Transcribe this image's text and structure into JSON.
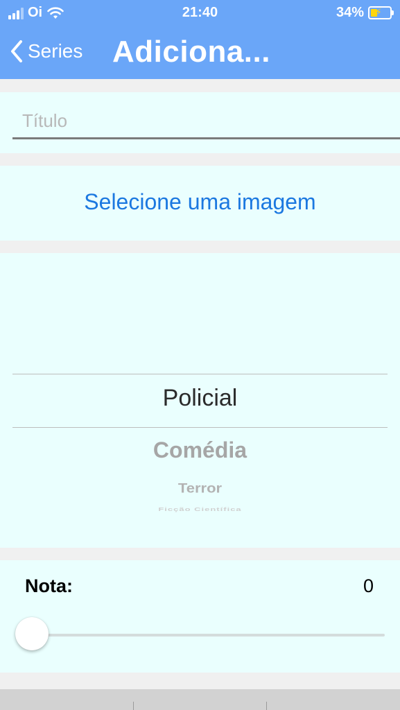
{
  "status_bar": {
    "carrier": "Oi",
    "time": "21:40",
    "battery_percent": "34%",
    "icons": [
      "signal-icon",
      "wifi-icon",
      "battery-charging-icon"
    ]
  },
  "nav": {
    "back_label": "Series",
    "title": "Adiciona..."
  },
  "form": {
    "title_placeholder": "Título",
    "select_image_label": "Selecione uma imagem",
    "genre_picker": {
      "selected": "Policial",
      "options": [
        "Policial",
        "Comédia",
        "Terror",
        "Ficção Científica"
      ]
    },
    "nota": {
      "label": "Nota:",
      "value": "0",
      "slider_fraction": 0
    }
  },
  "colors": {
    "nav_background": "#6aa6f8",
    "section_background": "#eafffe",
    "link_blue": "#1b78e0"
  }
}
